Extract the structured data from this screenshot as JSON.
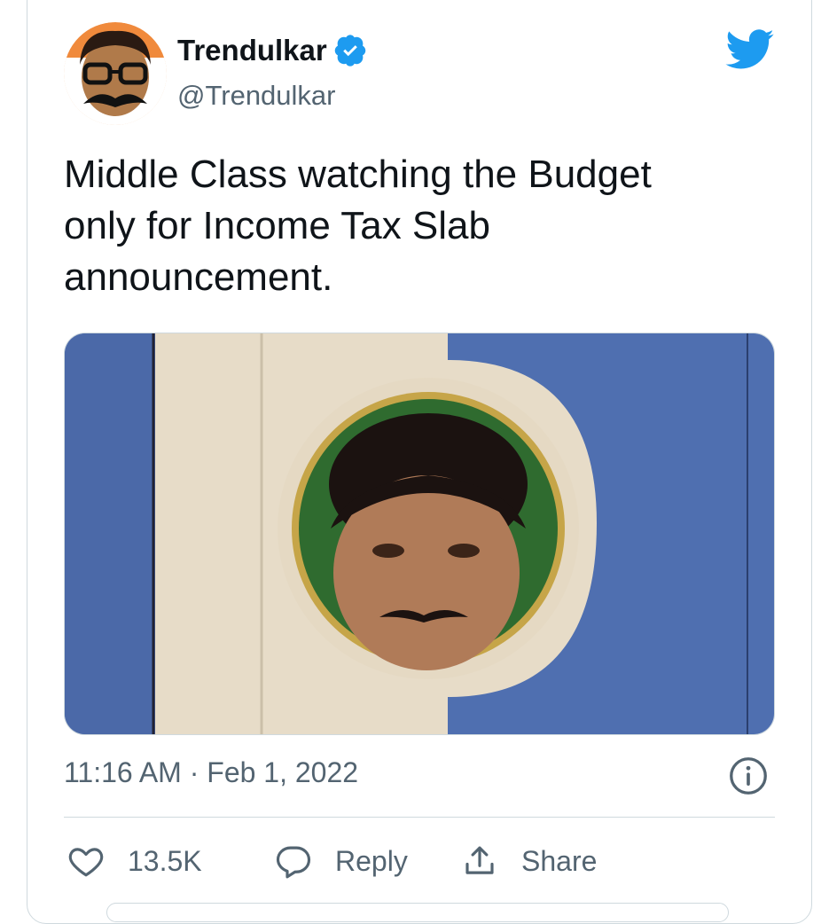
{
  "tweet": {
    "display_name": "Trendulkar",
    "handle": "@Trendulkar",
    "text_lines": [
      "Middle Class watching the Budget",
      "only for Income Tax Slab",
      "announcement."
    ],
    "timestamp": "11:16 AM · Feb 1, 2022"
  },
  "actions": {
    "like_count": "13.5K",
    "reply_label": "Reply",
    "share_label": "Share"
  },
  "icons": {
    "verified": "verified-badge-icon",
    "platform": "twitter-bird-icon",
    "info": "info-icon",
    "like": "heart-icon",
    "reply": "speech-bubble-icon",
    "share": "share-icon"
  },
  "colors": {
    "brand_blue": "#1d9bf0",
    "text_primary": "#0f1419",
    "text_secondary": "#536471",
    "border": "#cfd9de"
  }
}
